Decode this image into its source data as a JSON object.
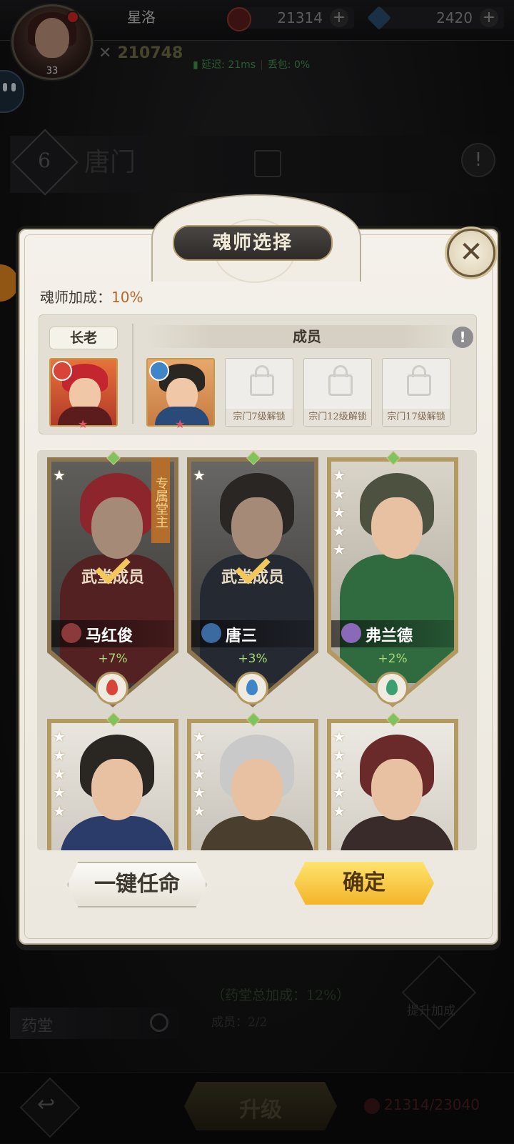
{
  "player": {
    "name": "星洛",
    "level": "33",
    "power": "210748"
  },
  "resources": {
    "gold": "21314",
    "diamond": "2420"
  },
  "network": {
    "latency": "延迟: 21ms",
    "loss": "丢包: 0%"
  },
  "sect": {
    "rank": "6",
    "name": "唐门"
  },
  "background": {
    "hall_name": "药堂",
    "hall_bonus": "（药堂总加成：12%）",
    "members": "成员：2/2",
    "raise_bonus": "提升加成",
    "upgrade": "升级",
    "cost": "21314/23040"
  },
  "modal": {
    "title": "魂师选择",
    "bonus_label": "魂师加成：",
    "bonus_value": "10%",
    "elder_label": "长老",
    "members_label": "成员",
    "locked_slots": [
      "宗门7级解锁",
      "宗门12级解锁",
      "宗门17级解锁"
    ],
    "appoint_all": "一键任命",
    "confirm": "确定"
  },
  "cards": [
    {
      "name": "马红俊",
      "tag": "专属堂主",
      "assigned": "武堂成员",
      "bonus": "+7%",
      "element": "fire",
      "star_count": 1
    },
    {
      "name": "唐三",
      "assigned": "武堂成员",
      "bonus": "+3%",
      "element": "water",
      "star_count": 1
    },
    {
      "name": "弗兰德",
      "bonus": "+2%",
      "element": "wind",
      "star_count": 5
    }
  ],
  "colors": {
    "accent": "#f3b52a",
    "bonus_green": "#a7d873",
    "bonus_orange": "#b06a2d"
  }
}
